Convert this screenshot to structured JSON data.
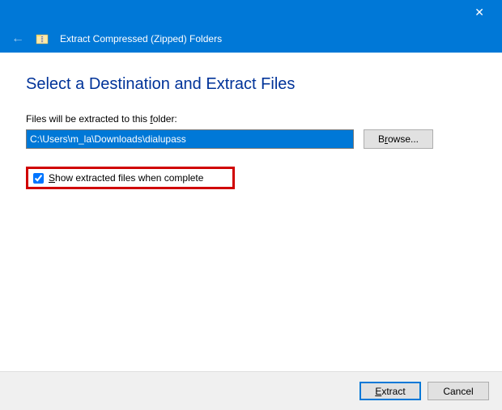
{
  "titlebar": {
    "close_glyph": "✕"
  },
  "header": {
    "back_glyph": "←",
    "title": "Extract Compressed (Zipped) Folders"
  },
  "content": {
    "heading": "Select a Destination and Extract Files",
    "folder_label_pre": "Files will be extracted to this ",
    "folder_label_u": "f",
    "folder_label_post": "older:",
    "path_value": "C:\\Users\\m_la\\Downloads\\dialupass",
    "browse_pre": "B",
    "browse_u": "r",
    "browse_post": "owse...",
    "checkbox_checked": true,
    "checkbox_u": "S",
    "checkbox_post": "how extracted files when complete"
  },
  "footer": {
    "extract_u": "E",
    "extract_post": "xtract",
    "cancel": "Cancel"
  }
}
